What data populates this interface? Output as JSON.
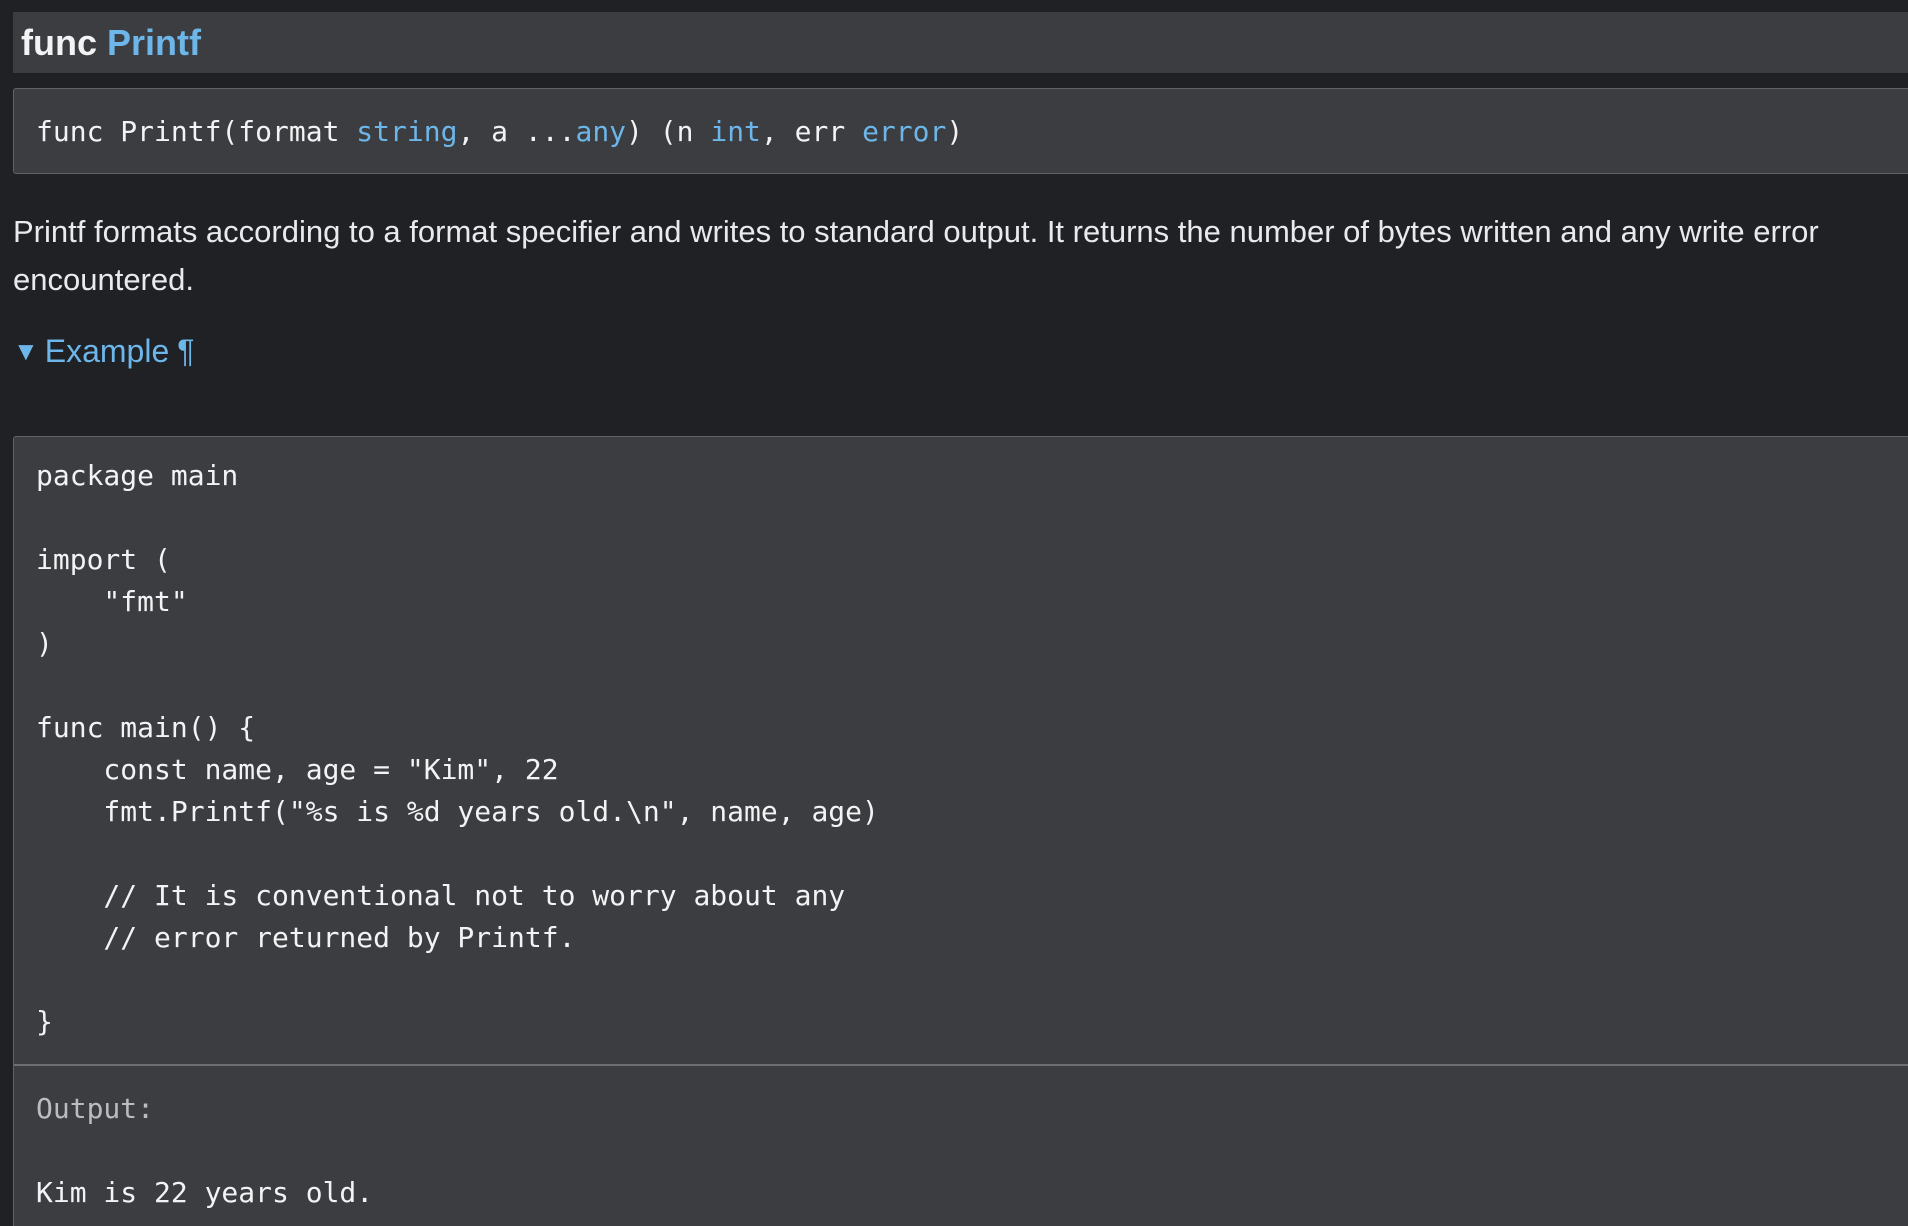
{
  "heading": {
    "keyword": "func",
    "name": "Printf"
  },
  "signature": {
    "part1": "func Printf(format ",
    "type1": "string",
    "part2": ", a ...",
    "type2": "any",
    "part3": ") (n ",
    "type3": "int",
    "part4": ", err ",
    "type4": "error",
    "part5": ")"
  },
  "description": "Printf formats according to a format specifier and writes to standard output. It returns the number of bytes written and any write error encountered.",
  "example": {
    "toggle_icon": "▼",
    "label": "Example",
    "anchor": "¶",
    "code": "package main\n\nimport (\n    \"fmt\"\n)\n\nfunc main() {\n    const name, age = \"Kim\", 22\n    fmt.Printf(\"%s is %d years old.\\n\", name, age)\n\n    // It is conventional not to worry about any\n    // error returned by Printf.\n\n}",
    "output_label": "Output:",
    "output": "Kim is 22 years old."
  },
  "colors": {
    "background": "#202124",
    "panel": "#3c3d40",
    "accent": "#6cb6ea"
  }
}
